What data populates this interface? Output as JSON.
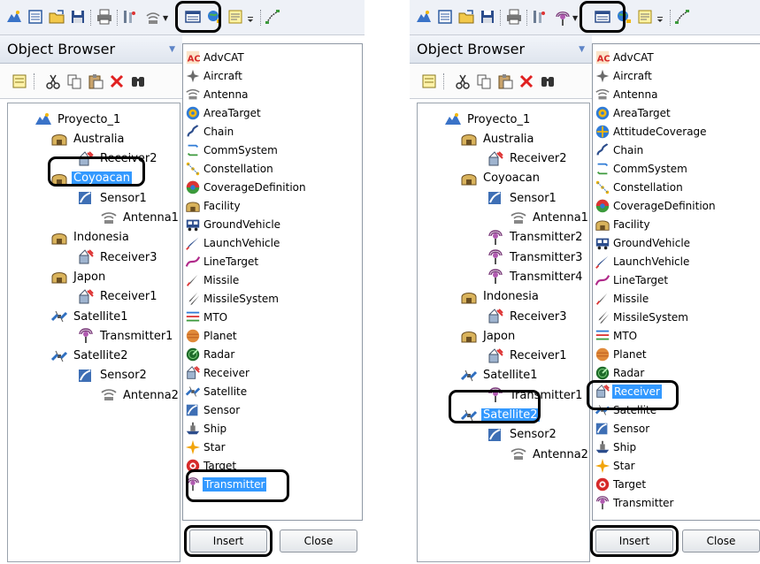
{
  "left_panel": {
    "object_browser_title": "Object Browser",
    "tree": [
      {
        "label": "Proyecto_1",
        "icon": "scenario-icon",
        "level": 0
      },
      {
        "label": "Australia",
        "icon": "facility-icon",
        "level": 1
      },
      {
        "label": "Receiver2",
        "icon": "receiver-icon",
        "level": 2
      },
      {
        "label": "Coyoacan",
        "icon": "facility-icon",
        "level": 1,
        "selected": true
      },
      {
        "label": "Sensor1",
        "icon": "sensor-icon",
        "level": 2
      },
      {
        "label": "Antenna1",
        "icon": "antenna-icon",
        "level": 3
      },
      {
        "label": "Indonesia",
        "icon": "facility-icon",
        "level": 1
      },
      {
        "label": "Receiver3",
        "icon": "receiver-icon",
        "level": 2
      },
      {
        "label": "Japon",
        "icon": "facility-icon",
        "level": 1
      },
      {
        "label": "Receiver1",
        "icon": "receiver-icon",
        "level": 2
      },
      {
        "label": "Satellite1",
        "icon": "satellite-icon",
        "level": 1
      },
      {
        "label": "Transmitter1",
        "icon": "transmitter-icon",
        "level": 2
      },
      {
        "label": "Satellite2",
        "icon": "satellite-icon",
        "level": 1
      },
      {
        "label": "Sensor2",
        "icon": "sensor-icon",
        "level": 2
      },
      {
        "label": "Antenna2",
        "icon": "antenna-icon",
        "level": 3
      }
    ],
    "object_types": [
      {
        "label": "AdvCAT",
        "icon": "advcat-icon"
      },
      {
        "label": "Aircraft",
        "icon": "aircraft-icon"
      },
      {
        "label": "Antenna",
        "icon": "antenna-icon"
      },
      {
        "label": "AreaTarget",
        "icon": "areatarget-icon"
      },
      {
        "label": "Chain",
        "icon": "chain-icon"
      },
      {
        "label": "CommSystem",
        "icon": "commsystem-icon"
      },
      {
        "label": "Constellation",
        "icon": "constellation-icon"
      },
      {
        "label": "CoverageDefinition",
        "icon": "coverage-icon"
      },
      {
        "label": "Facility",
        "icon": "facility-icon"
      },
      {
        "label": "GroundVehicle",
        "icon": "groundvehicle-icon"
      },
      {
        "label": "LaunchVehicle",
        "icon": "launchvehicle-icon"
      },
      {
        "label": "LineTarget",
        "icon": "linetarget-icon"
      },
      {
        "label": "Missile",
        "icon": "missile-icon"
      },
      {
        "label": "MissileSystem",
        "icon": "missilesystem-icon"
      },
      {
        "label": "MTO",
        "icon": "mto-icon"
      },
      {
        "label": "Planet",
        "icon": "planet-icon"
      },
      {
        "label": "Radar",
        "icon": "radar-icon"
      },
      {
        "label": "Receiver",
        "icon": "receiver-icon"
      },
      {
        "label": "Satellite",
        "icon": "satellite-icon"
      },
      {
        "label": "Sensor",
        "icon": "sensor-icon"
      },
      {
        "label": "Ship",
        "icon": "ship-icon"
      },
      {
        "label": "Star",
        "icon": "star-icon"
      },
      {
        "label": "Target",
        "icon": "target-icon"
      },
      {
        "label": "Transmitter",
        "icon": "transmitter-icon",
        "selected": true
      }
    ],
    "insert_label": "Insert",
    "close_label": "Close"
  },
  "right_panel": {
    "object_browser_title": "Object Browser",
    "tree": [
      {
        "label": "Proyecto_1",
        "icon": "scenario-icon",
        "level": 0
      },
      {
        "label": "Australia",
        "icon": "facility-icon",
        "level": 1
      },
      {
        "label": "Receiver2",
        "icon": "receiver-icon",
        "level": 2
      },
      {
        "label": "Coyoacan",
        "icon": "facility-icon",
        "level": 1
      },
      {
        "label": "Sensor1",
        "icon": "sensor-icon",
        "level": 2
      },
      {
        "label": "Antenna1",
        "icon": "antenna-icon",
        "level": 3
      },
      {
        "label": "Transmitter2",
        "icon": "transmitter-icon",
        "level": 2
      },
      {
        "label": "Transmitter3",
        "icon": "transmitter-icon",
        "level": 2
      },
      {
        "label": "Transmitter4",
        "icon": "transmitter-icon",
        "level": 2
      },
      {
        "label": "Indonesia",
        "icon": "facility-icon",
        "level": 1
      },
      {
        "label": "Receiver3",
        "icon": "receiver-icon",
        "level": 2
      },
      {
        "label": "Japon",
        "icon": "facility-icon",
        "level": 1
      },
      {
        "label": "Receiver1",
        "icon": "receiver-icon",
        "level": 2
      },
      {
        "label": "Satellite1",
        "icon": "satellite-icon",
        "level": 1
      },
      {
        "label": "Transmitter1",
        "icon": "transmitter-icon",
        "level": 2
      },
      {
        "label": "Satellite2",
        "icon": "satellite-icon",
        "level": 1,
        "selected": true
      },
      {
        "label": "Sensor2",
        "icon": "sensor-icon",
        "level": 2
      },
      {
        "label": "Antenna2",
        "icon": "antenna-icon",
        "level": 3
      }
    ],
    "object_types": [
      {
        "label": "AdvCAT",
        "icon": "advcat-icon"
      },
      {
        "label": "Aircraft",
        "icon": "aircraft-icon"
      },
      {
        "label": "Antenna",
        "icon": "antenna-icon"
      },
      {
        "label": "AreaTarget",
        "icon": "areatarget-icon"
      },
      {
        "label": "AttitudeCoverage",
        "icon": "attitudecoverage-icon"
      },
      {
        "label": "Chain",
        "icon": "chain-icon"
      },
      {
        "label": "CommSystem",
        "icon": "commsystem-icon"
      },
      {
        "label": "Constellation",
        "icon": "constellation-icon"
      },
      {
        "label": "CoverageDefinition",
        "icon": "coverage-icon"
      },
      {
        "label": "Facility",
        "icon": "facility-icon"
      },
      {
        "label": "GroundVehicle",
        "icon": "groundvehicle-icon"
      },
      {
        "label": "LaunchVehicle",
        "icon": "launchvehicle-icon"
      },
      {
        "label": "LineTarget",
        "icon": "linetarget-icon"
      },
      {
        "label": "Missile",
        "icon": "missile-icon"
      },
      {
        "label": "MissileSystem",
        "icon": "missilesystem-icon"
      },
      {
        "label": "MTO",
        "icon": "mto-icon"
      },
      {
        "label": "Planet",
        "icon": "planet-icon"
      },
      {
        "label": "Radar",
        "icon": "radar-icon"
      },
      {
        "label": "Receiver",
        "icon": "receiver-icon",
        "selected": true
      },
      {
        "label": "Satellite",
        "icon": "satellite-icon"
      },
      {
        "label": "Sensor",
        "icon": "sensor-icon"
      },
      {
        "label": "Ship",
        "icon": "ship-icon"
      },
      {
        "label": "Star",
        "icon": "star-icon"
      },
      {
        "label": "Target",
        "icon": "target-icon"
      },
      {
        "label": "Transmitter",
        "icon": "transmitter-icon"
      }
    ],
    "insert_label": "Insert",
    "close_label": "Close"
  },
  "colors": {
    "selection": "#3399ff",
    "highlight_outline": "#000000",
    "header_gradient_top": "#f2f5fa",
    "header_gradient_bottom": "#dfe5ee"
  }
}
